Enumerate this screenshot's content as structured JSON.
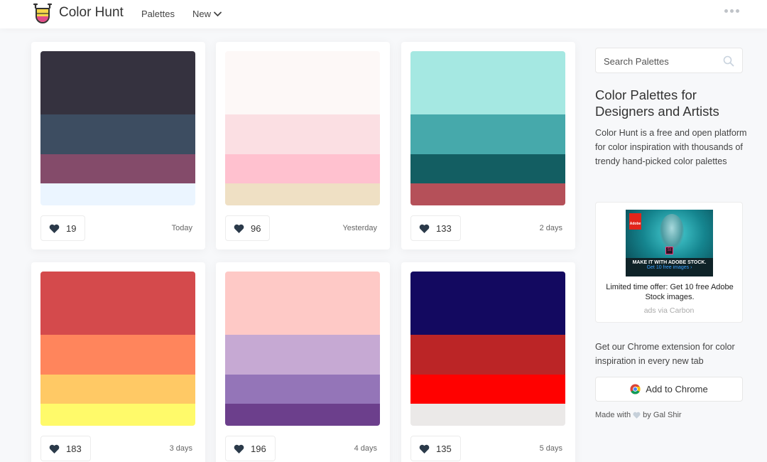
{
  "header": {
    "brand": "Color Hunt",
    "nav_palettes": "Palettes",
    "nav_new": "New"
  },
  "palettes": [
    {
      "colors": [
        "#35323f",
        "#3d4d61",
        "#844b6a",
        "#ebf5ff"
      ],
      "likes": "19",
      "when": "Today"
    },
    {
      "colors": [
        "#fdf8f7",
        "#fbdfe3",
        "#ffc1cf",
        "#efe0c4"
      ],
      "likes": "96",
      "when": "Yesterday"
    },
    {
      "colors": [
        "#a5e8e2",
        "#46a9ab",
        "#135e62",
        "#b55059"
      ],
      "likes": "133",
      "when": "2 days"
    },
    {
      "colors": [
        "#d44a4c",
        "#ff855c",
        "#ffc965",
        "#fffa6a"
      ],
      "likes": "183",
      "when": "3 days"
    },
    {
      "colors": [
        "#fec9c6",
        "#c6a9d3",
        "#9475b8",
        "#6c3f8c"
      ],
      "likes": "196",
      "when": "4 days"
    },
    {
      "colors": [
        "#130960",
        "#bb2526",
        "#ff0100",
        "#ebe9e8"
      ],
      "likes": "135",
      "when": "5 days"
    }
  ],
  "sidebar": {
    "search_placeholder": "Search Palettes",
    "title": "Color Palettes for Designers and Artists",
    "description": "Color Hunt is a free and open platform for color inspiration with thousands of trendy hand-picked color palettes",
    "ad": {
      "image_line1": "MAKE IT WITH ADOBE STOCK.",
      "image_line2": "Get 10 free images ›",
      "brand_mark": "Adobe",
      "product_mark": "St",
      "text": "Limited time offer: Get 10 free Adobe Stock images.",
      "via": "ads via Carbon"
    },
    "extension_text": "Get our Chrome extension for color inspiration in every new tab",
    "chrome_button": "Add to Chrome",
    "credit_prefix": "Made with",
    "credit_suffix": "by Gal Shir"
  },
  "icons": {
    "logo": "color-hunt-logo",
    "chevron": "chevron-down-icon",
    "more": "more-dots-icon",
    "search": "search-icon",
    "heart": "heart-icon",
    "chrome": "chrome-icon"
  }
}
